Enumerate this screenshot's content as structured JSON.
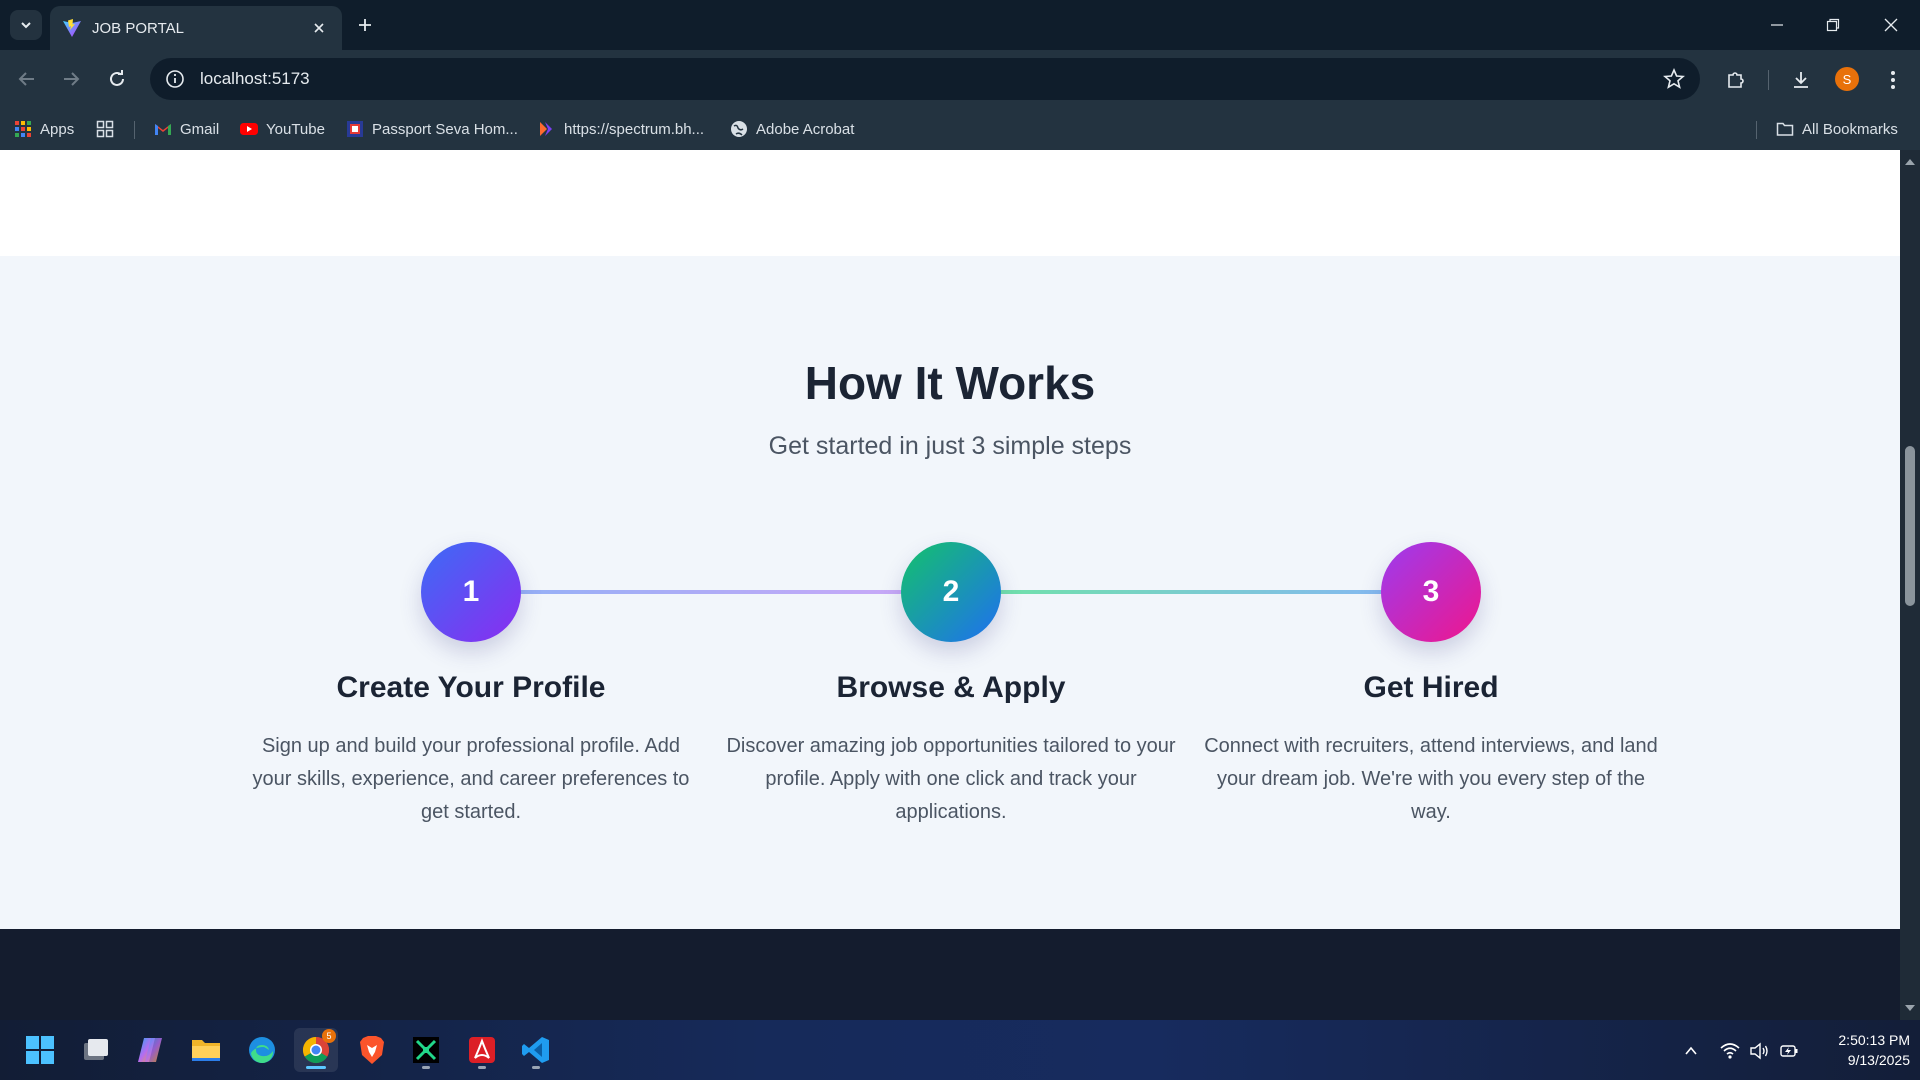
{
  "browser": {
    "tab_title": "JOB PORTAL",
    "url": "localhost:5173",
    "profile_initial": "S",
    "bookmarks": [
      {
        "label": "Apps",
        "icon": "apps-grid-icon"
      },
      {
        "label": "",
        "icon": "tab-groups-icon"
      },
      {
        "label": "Gmail",
        "icon": "gmail-icon"
      },
      {
        "label": "YouTube",
        "icon": "youtube-icon"
      },
      {
        "label": "Passport Seva Hom...",
        "icon": "passport-seva-icon"
      },
      {
        "label": "https://spectrum.bh...",
        "icon": "spectrum-icon"
      },
      {
        "label": "Adobe Acrobat",
        "icon": "globe-icon"
      }
    ],
    "all_bookmarks": "All Bookmarks"
  },
  "page": {
    "how_it_works": {
      "title": "How It Works",
      "subtitle": "Get started in just 3 simple steps",
      "steps": [
        {
          "number": "1",
          "title": "Create Your Profile",
          "description": "Sign up and build your professional profile. Add your skills, experience, and career preferences to get started.",
          "gradient": [
            "#3b6cf6",
            "#8b2cf0"
          ]
        },
        {
          "number": "2",
          "title": "Browse & Apply",
          "description": "Discover amazing job opportunities tailored to your profile. Apply with one click and track your applications.",
          "gradient": [
            "#14c26a",
            "#1f6ff2"
          ]
        },
        {
          "number": "3",
          "title": "Get Hired",
          "description": "Connect with recruiters, attend interviews, and land your dream job. We're with you every step of the way.",
          "gradient": [
            "#9b3cf0",
            "#f0168c"
          ]
        }
      ]
    }
  },
  "taskbar": {
    "time": "2:50:13 PM",
    "date": "9/13/2025",
    "chrome_badge": "5",
    "apps": [
      "start-icon",
      "task-view-icon",
      "copilot-icon",
      "file-explorer-icon",
      "edge-icon",
      "chrome-icon",
      "brave-icon",
      "python-ide-icon",
      "acrobat-icon",
      "vscode-icon"
    ]
  },
  "colors": {
    "section_bg": "#f2f6fb",
    "heading": "#1b2434",
    "body_text": "#4b5563",
    "footer_bg": "#141c2e",
    "chrome_dark": "#0f1d2b",
    "chrome_mid": "#233340"
  }
}
